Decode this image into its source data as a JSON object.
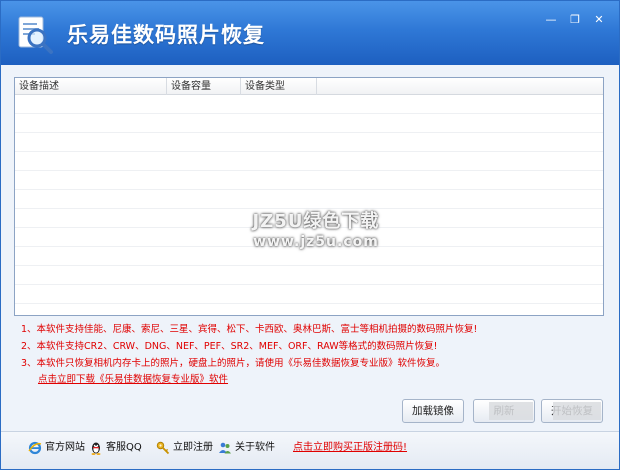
{
  "window": {
    "title": "乐易佳数码照片恢复",
    "controls": {
      "minimize": "—",
      "restore": "❐",
      "close": "✕"
    },
    "colors": {
      "title_bar": "#2f78d6",
      "notice_red": "#e00000"
    }
  },
  "device_list": {
    "columns": [
      "设备描述",
      "设备容量",
      "设备类型"
    ],
    "rows": []
  },
  "watermark": {
    "line1": "JZ5U绿色下载",
    "line2": "www.jz5u.com"
  },
  "notes": [
    "1、本软件支持佳能、尼康、索尼、三星、宾得、松下、卡西欧、奥林巴斯、富士等相机拍摄的数码照片恢复!",
    "2、本软件支持CR2、CRW、DNG、NEF、PEF、SR2、MEF、ORF、RAW等格式的数码照片恢复!",
    "3、本软件只恢复相机内存卡上的照片，硬盘上的照片，请使用《乐易佳数据恢复专业版》软件恢复。"
  ],
  "download_link": "点击立即下载《乐易佳数据恢复专业版》软件",
  "buttons": {
    "load_image": "加载镜像",
    "refresh": "刷新",
    "recover": "开始恢复"
  },
  "bottom_bar": {
    "official_site": "官方网站",
    "qq_support": "客服QQ",
    "register_now": "立即注册",
    "about": "关于软件",
    "buy_link": "点击立即购买正版注册码!"
  },
  "icons": {
    "logo": "magnifier-document-icon",
    "site": "ie-icon",
    "qq": "qq-penguin-icon",
    "register": "key-icon",
    "about": "people-icon"
  }
}
